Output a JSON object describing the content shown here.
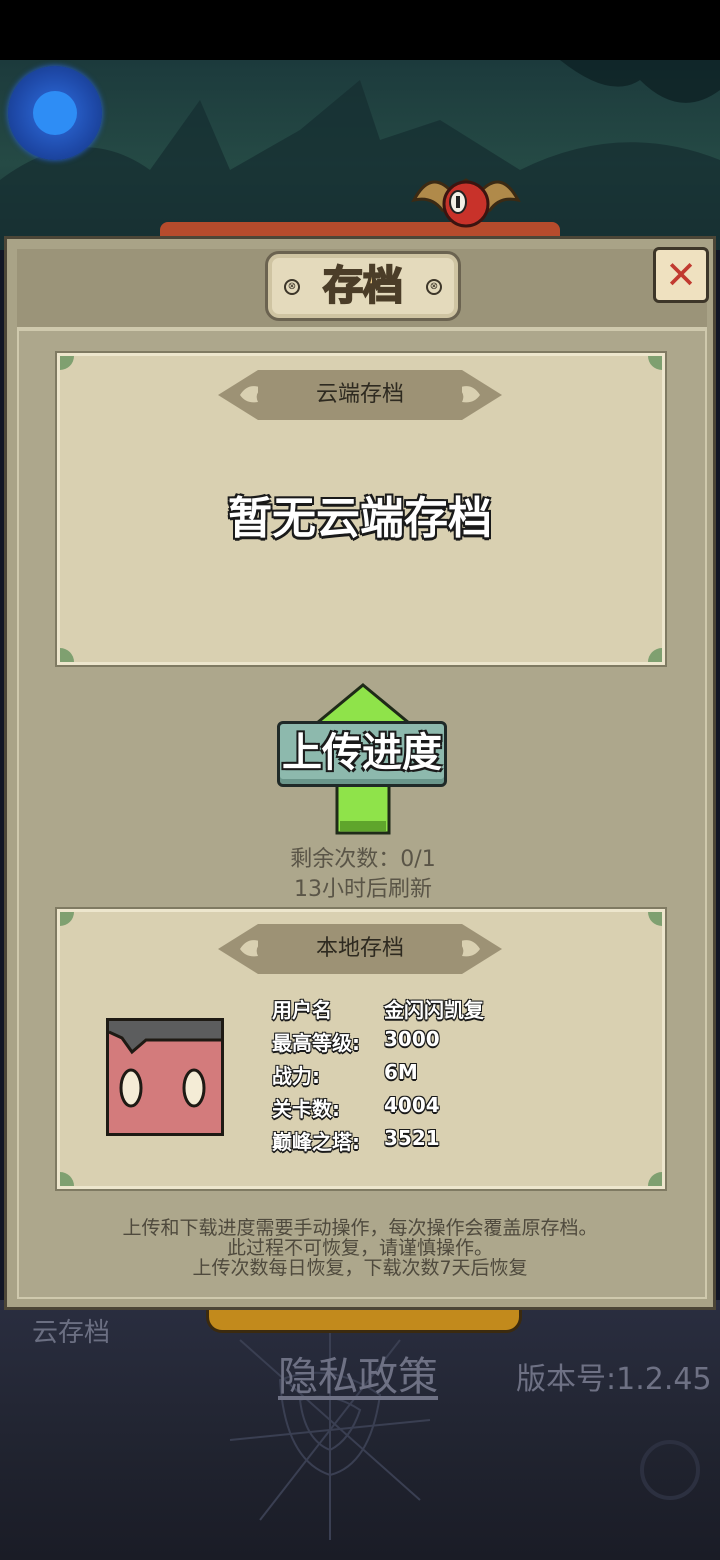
{
  "dialog": {
    "title": "存档",
    "close_label": "✕"
  },
  "cloud_save": {
    "header": "云端存档",
    "empty_message": "暂无云端存档"
  },
  "upload": {
    "button_label": "上传进度",
    "remaining": "剩余次数：0/1",
    "refresh": "13小时后刷新"
  },
  "local_save": {
    "header": "本地存档",
    "fields": [
      {
        "label": "用户名",
        "value": "金闪闪凯复"
      },
      {
        "label": "最高等级:",
        "value": "3000"
      },
      {
        "label": "战力:",
        "value": "6M"
      },
      {
        "label": "关卡数:",
        "value": "4004"
      },
      {
        "label": "巅峰之塔:",
        "value": "3521"
      }
    ]
  },
  "notes": [
    "上传和下载进度需要手动操作，每次操作会覆盖原存档。",
    "此过程不可恢复，请谨慎操作。",
    "上传次数每日恢复，下载次数7天后恢复"
  ],
  "background": {
    "cloud_save_label": "云存档",
    "privacy_policy": "隐私政策",
    "version": "版本号:1.2.45"
  },
  "colors": {
    "panel": "#a9a387",
    "card": "#d9d0b1",
    "upload_arrow": "#8fe34a",
    "close_x": "#c13a30"
  }
}
